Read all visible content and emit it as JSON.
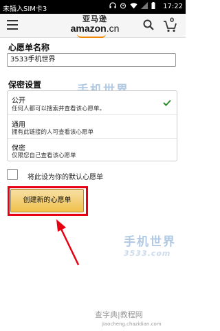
{
  "status_bar": {
    "carrier": "未插入SIM卡3",
    "time": "17:22",
    "icons": [
      "headphones-icon",
      "alarm-icon",
      "wifi-icon",
      "signal-icon",
      "battery-icon"
    ]
  },
  "header": {
    "logo_cn": "亚马逊",
    "logo_word": "amazon",
    "logo_suffix": ".cn",
    "cart_count": "0",
    "accent_color": "#f08804"
  },
  "form": {
    "name_label": "心愿单名称",
    "name_value": "3533手机世界",
    "privacy_label": "保密设置",
    "options": [
      {
        "title": "公开",
        "desc": "任何人都可以搜索并查看该心愿单。",
        "selected": true
      },
      {
        "title": "通用",
        "desc": "拥有此链接的人可查看该心愿单",
        "selected": false
      },
      {
        "title": "保密",
        "desc": "仅限您自己查看该心愿单",
        "selected": false
      }
    ],
    "default_checkbox_label": "将此设为你的默认心愿单",
    "create_button": "创建新的心愿单"
  },
  "watermarks": {
    "brand": "手机世界",
    "site_num": "3533.com",
    "footer_cn": "查字典|教程网",
    "footer_url": "jiaocheng.chazidian.com"
  }
}
